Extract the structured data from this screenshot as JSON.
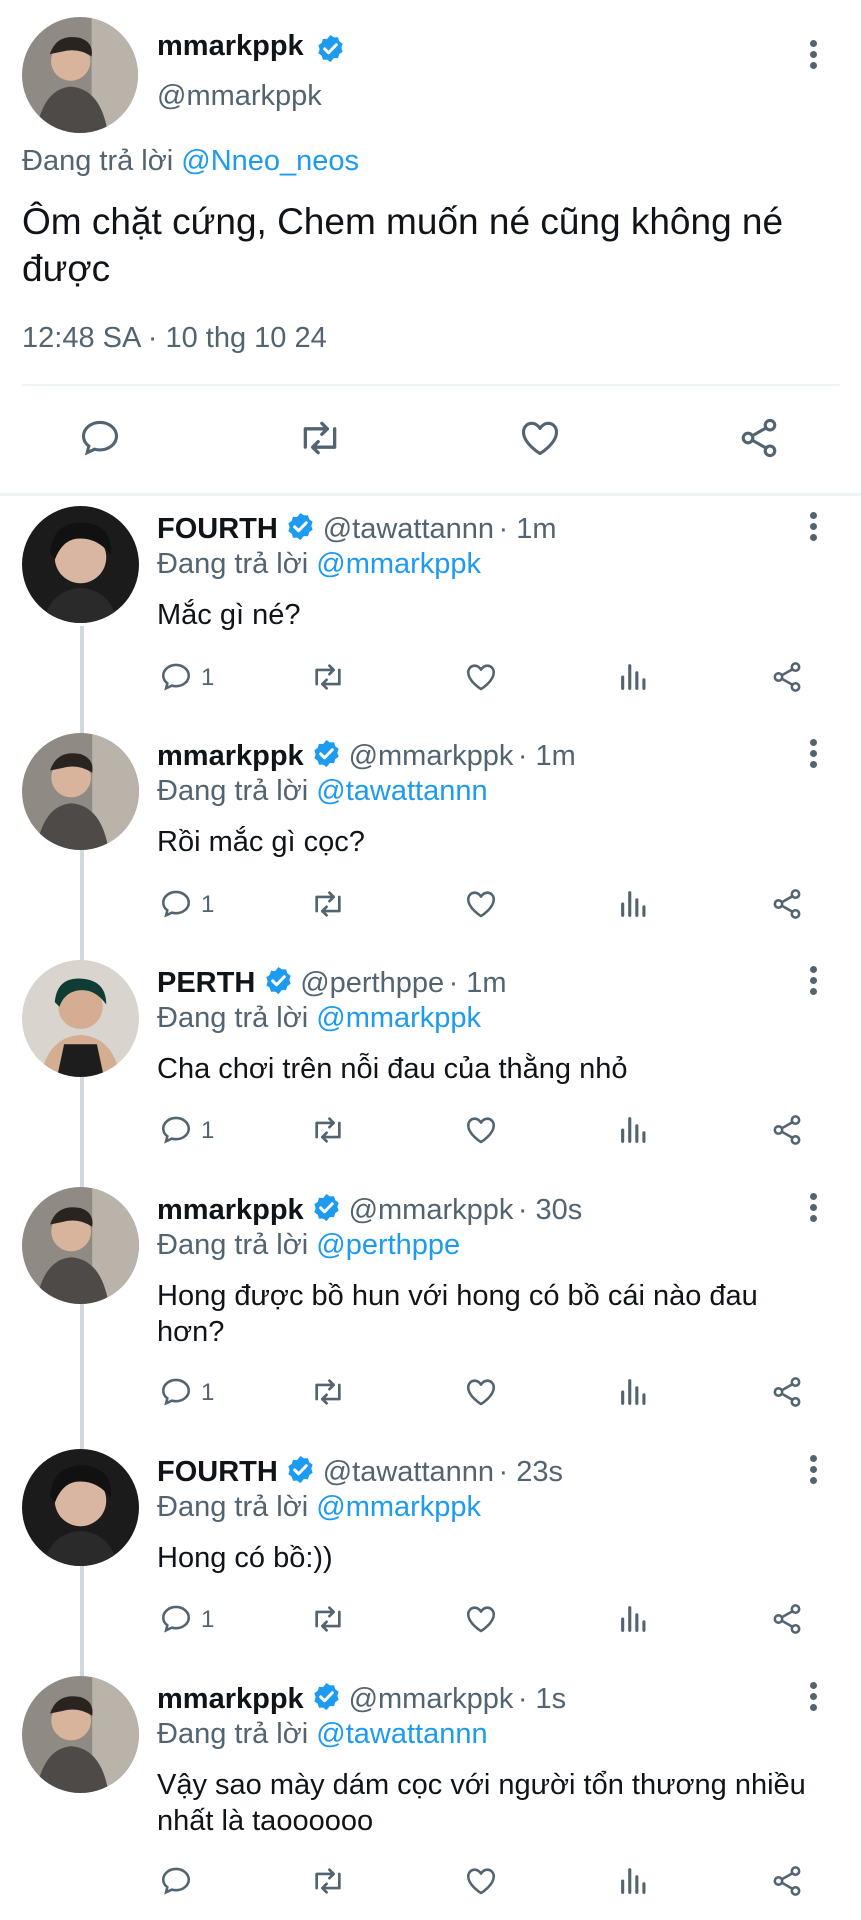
{
  "main_tweet": {
    "display_name": "mmarkppk",
    "handle": "@mmarkppk",
    "reply_prefix": "Đang trả lời",
    "reply_to": "@Nneo_neos",
    "text": "Ôm chặt cứng, Chem muốn né cũng không né được",
    "timestamp": "12:48 SA · 10 thg 10 24"
  },
  "replies": [
    {
      "display_name": "FOURTH",
      "handle": "@tawattannn",
      "time": "· 1m",
      "reply_prefix": "Đang trả lời",
      "reply_to": "@mmarkppk",
      "text": "Mắc gì né?",
      "reply_count": "1"
    },
    {
      "display_name": "mmarkppk",
      "handle": "@mmarkppk",
      "time": "· 1m",
      "reply_prefix": "Đang trả lời",
      "reply_to": "@tawattannn",
      "text": "Rồi mắc gì cọc?",
      "reply_count": "1"
    },
    {
      "display_name": "PERTH",
      "handle": "@perthppe",
      "time": "· 1m",
      "reply_prefix": "Đang trả lời",
      "reply_to": "@mmarkppk",
      "text": "Cha chơi trên nỗi đau của thằng nhỏ",
      "reply_count": "1"
    },
    {
      "display_name": "mmarkppk",
      "handle": "@mmarkppk",
      "time": "· 30s",
      "reply_prefix": "Đang trả lời",
      "reply_to": "@perthppe",
      "text": "Hong được bồ hun với hong có bồ cái nào đau hơn?",
      "reply_count": "1"
    },
    {
      "display_name": "FOURTH",
      "handle": "@tawattannn",
      "time": "· 23s",
      "reply_prefix": "Đang trả lời",
      "reply_to": "@mmarkppk",
      "text": "Hong có bồ:))",
      "reply_count": "1"
    },
    {
      "display_name": "mmarkppk",
      "handle": "@mmarkppk",
      "time": "· 1s",
      "reply_prefix": "Đang trả lời",
      "reply_to": "@tawattannn",
      "text": "Vậy sao mày dám cọc với người tổn thương nhiều nhất là taoooooo",
      "reply_count": ""
    }
  ],
  "colors": {
    "link": "#1d9bf0",
    "verified": "#1d9bf0",
    "muted": "#536471"
  }
}
